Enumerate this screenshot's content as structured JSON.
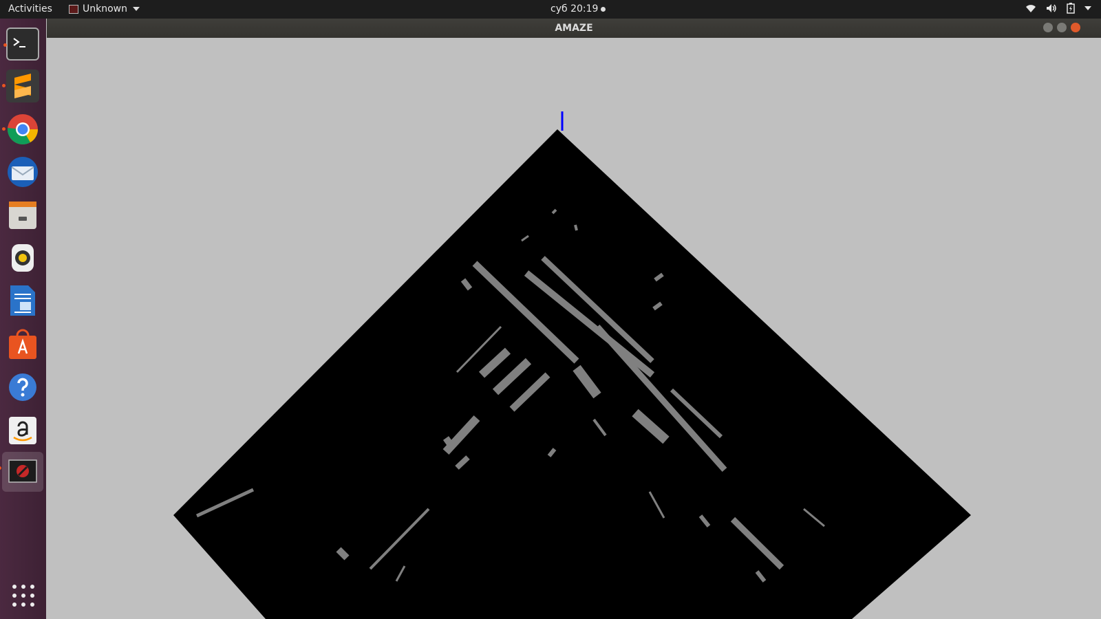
{
  "topbar": {
    "activities": "Activities",
    "app_menu": "Unknown",
    "clock": "суб 20:19"
  },
  "window": {
    "title": "AMAZE"
  },
  "dock": {
    "items": [
      {
        "name": "Terminal",
        "icon": "terminal-icon"
      },
      {
        "name": "Sublime Text",
        "icon": "sublime-icon"
      },
      {
        "name": "Google Chrome",
        "icon": "chrome-icon"
      },
      {
        "name": "Thunderbird Mail",
        "icon": "thunderbird-icon"
      },
      {
        "name": "Files",
        "icon": "files-icon"
      },
      {
        "name": "Rhythmbox",
        "icon": "rhythmbox-icon"
      },
      {
        "name": "LibreOffice Writer",
        "icon": "writer-icon"
      },
      {
        "name": "Ubuntu Software",
        "icon": "software-store-icon"
      },
      {
        "name": "Help",
        "icon": "help-icon"
      },
      {
        "name": "Amazon",
        "icon": "amazon-icon"
      },
      {
        "name": "AMAZE",
        "icon": "amaze-app-icon"
      }
    ]
  },
  "colors": {
    "background": "#c0c0c0",
    "floor": "#000000",
    "walls": "#808080",
    "player_marker": "#0000ff",
    "accent": "#e95420"
  }
}
